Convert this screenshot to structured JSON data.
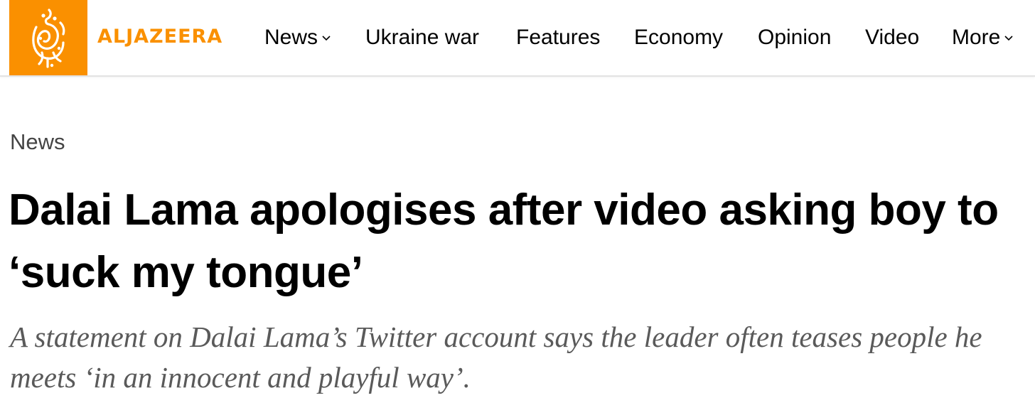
{
  "site": {
    "brand_name": "ALJAZEERA",
    "brand_color": "#fa9000",
    "logo_icon": "aljazeera-calligraphy-logo-icon"
  },
  "nav": {
    "items": [
      {
        "label": "News",
        "has_dropdown": true
      },
      {
        "label": "Ukraine war",
        "has_dropdown": false
      },
      {
        "label": "Features",
        "has_dropdown": false
      },
      {
        "label": "Economy",
        "has_dropdown": false
      },
      {
        "label": "Opinion",
        "has_dropdown": false
      },
      {
        "label": "Video",
        "has_dropdown": false
      },
      {
        "label": "More",
        "has_dropdown": true
      }
    ],
    "dropdown_icon": "chevron-down-icon"
  },
  "article": {
    "section": "News",
    "headline": "Dalai Lama apologises after video asking boy to ‘suck my tongue’",
    "standfirst": "A statement on Dalai Lama’s Twitter account says the leader often teases people he meets ‘in an innocent and playful way’."
  }
}
